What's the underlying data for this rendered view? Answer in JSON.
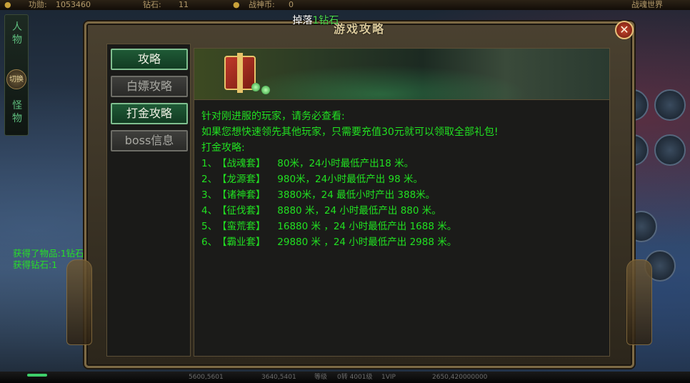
{
  "top_bar": {
    "stat1_label": "功勋:",
    "stat1_value": "1053460",
    "stat2_label": "钻石:",
    "stat2_value": "11",
    "stat3_label": "战神币:",
    "stat3_value": "0",
    "server_label": "战魂世界"
  },
  "left_strip": {
    "tab_role": "人物",
    "switch_label": "切换",
    "tab_monster": "怪物"
  },
  "chat_log": [
    "获得了物品:1钻石",
    "获得钻石:1"
  ],
  "drop_notice": {
    "prefix": " 掉落",
    "item": "1钻石"
  },
  "dialog": {
    "title": "游戏攻略",
    "close_symbol": "✕",
    "tabs": [
      {
        "label": "攻略",
        "active": true
      },
      {
        "label": "白嫖攻略",
        "active": false
      },
      {
        "label": "打金攻略",
        "active": true
      },
      {
        "label": "boss信息",
        "active": false
      }
    ],
    "content": {
      "intro": [
        "针对刚进服的玩家，请务必查看:",
        "如果您想快速领先其他玩家，只需要充值30元就可以领取全部礼包!",
        "打金攻略:"
      ],
      "items": [
        {
          "no": "1、",
          "name": "【战魂套】",
          "detail": " 80米，24小时最低产出18 米。"
        },
        {
          "no": "2、",
          "name": "【龙源套】",
          "detail": " 980米，24小时最低产出 98 米。"
        },
        {
          "no": "3、",
          "name": "【诸神套】",
          "detail": " 3880米，24 最低小时产出 388米。"
        },
        {
          "no": "4、",
          "name": "【征伐套】",
          "detail": " 8880 米，24 小时最低产出 880 米。"
        },
        {
          "no": "5、",
          "name": "【蛮荒套】",
          "detail": " 16880 米 ，24 小时最低产出 1688 米。"
        },
        {
          "no": "6、",
          "name": "【霸业套】",
          "detail": " 29880 米 ，24 小时最低产出 2988 米。"
        }
      ]
    }
  },
  "bottom_bar": {
    "coord1": "5600,5601",
    "coord2": "3640,5401",
    "level": "等级",
    "exp": "0转 4001级",
    "sep": "1VIP",
    "gold": "2650,420000000"
  },
  "colors": {
    "text_green": "#21e021",
    "tab_active": "#1f5a36",
    "frame_gold": "#7d6a45"
  }
}
